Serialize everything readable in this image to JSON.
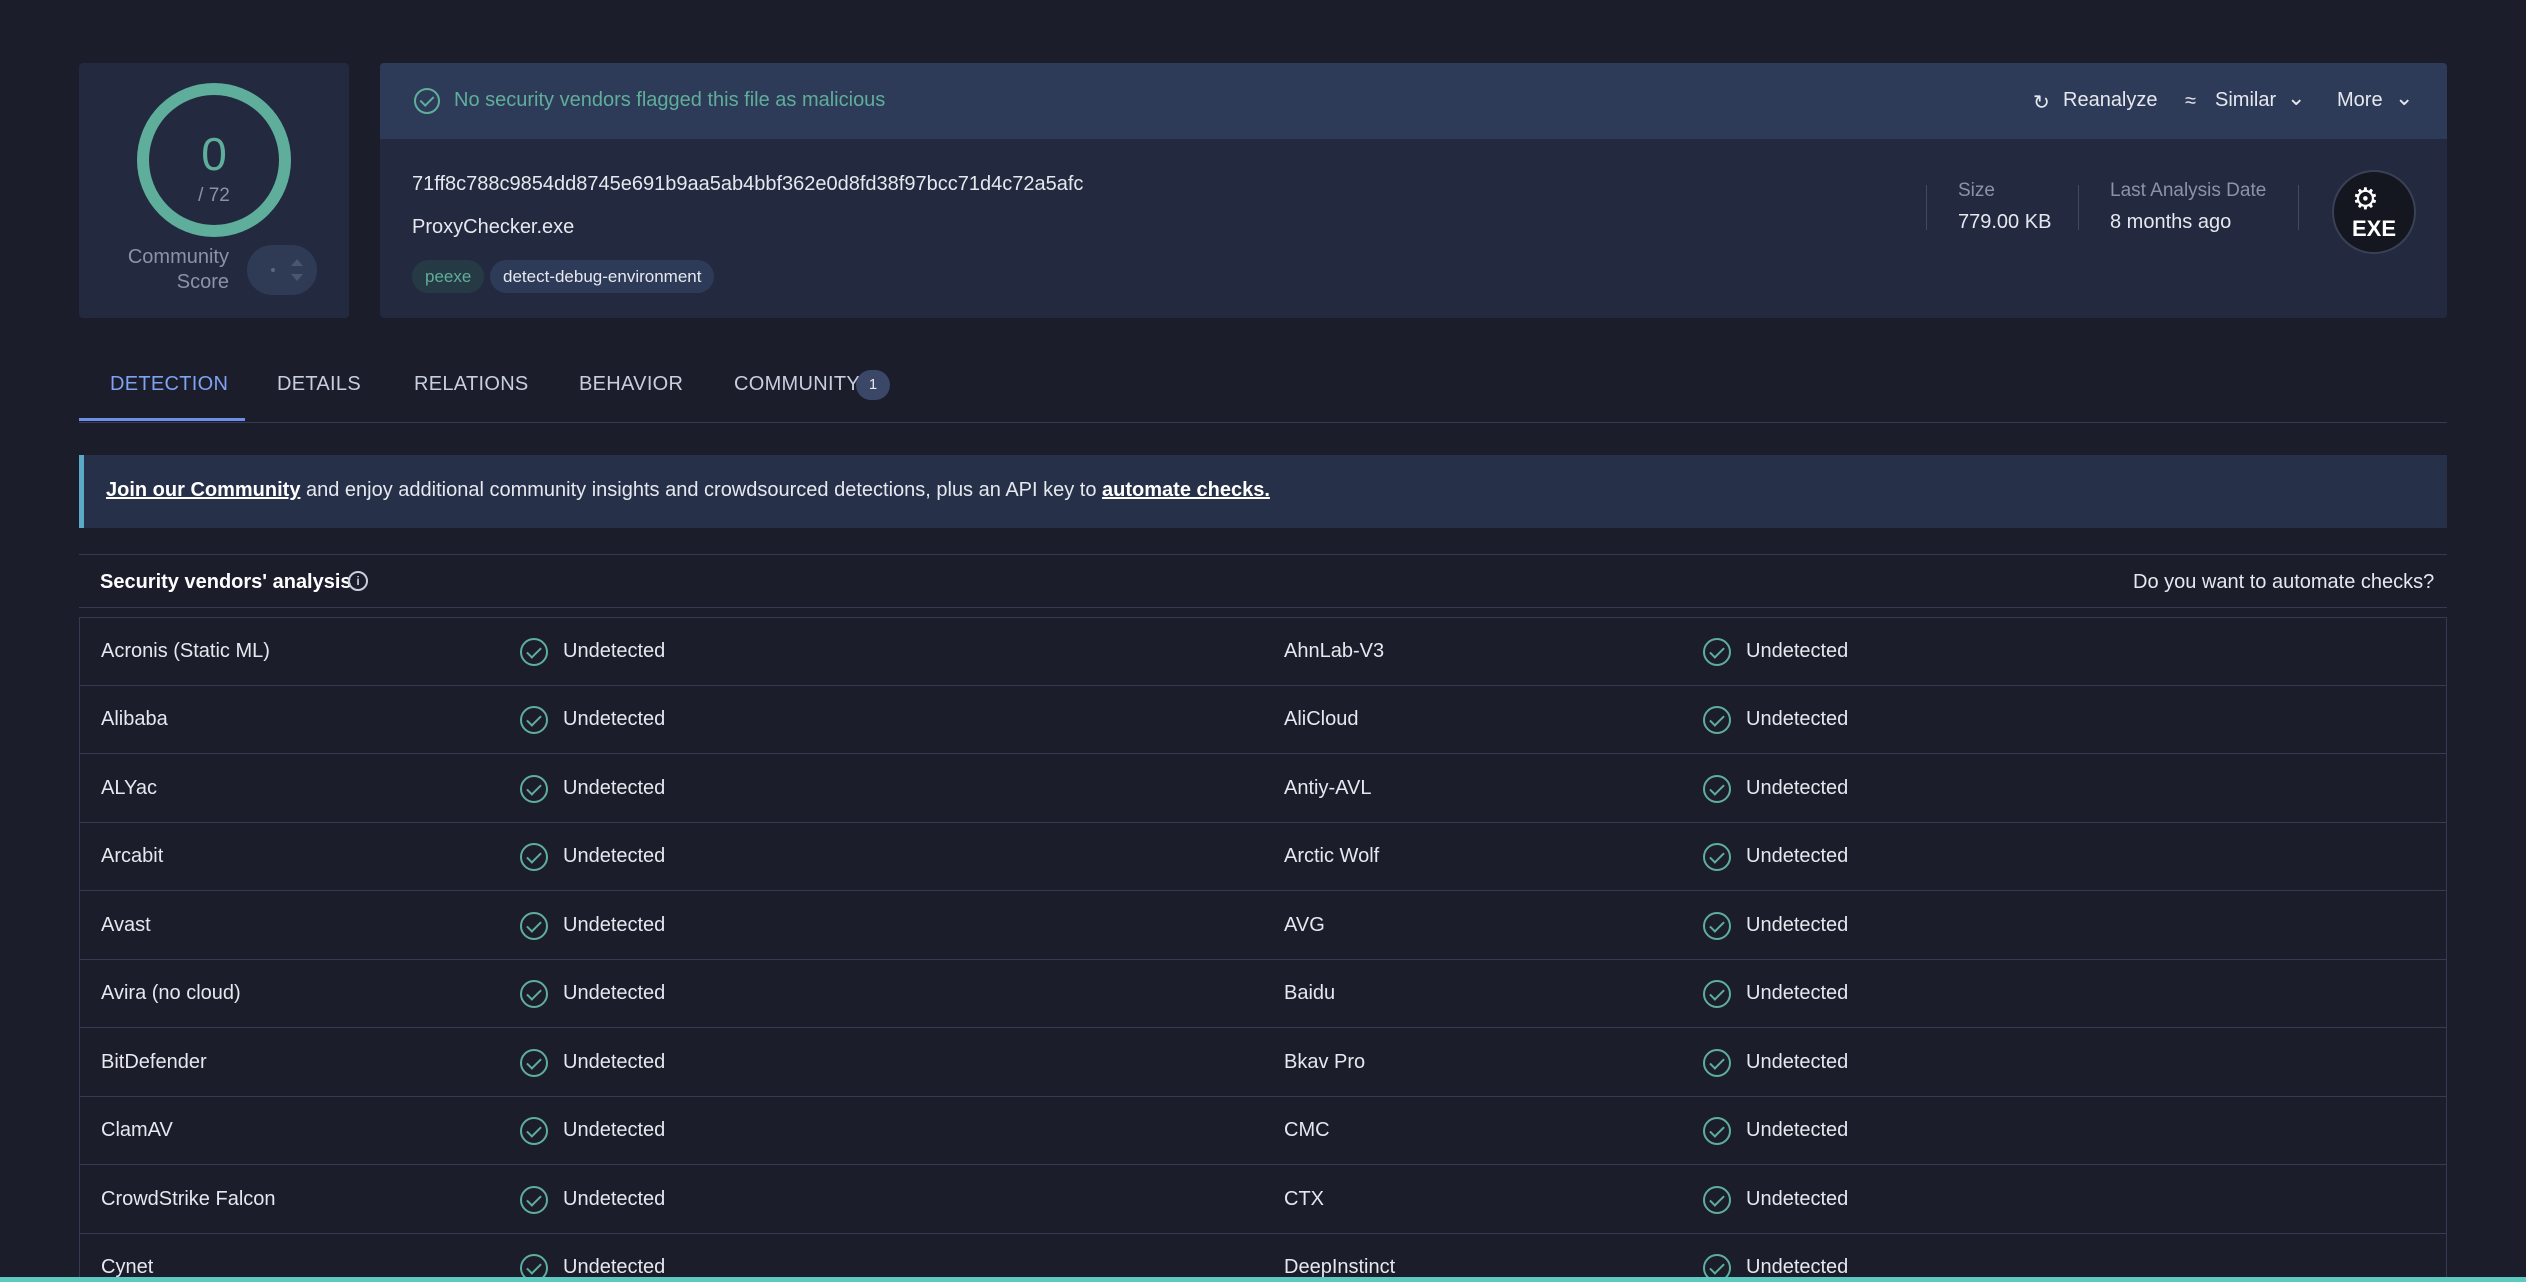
{
  "score": {
    "detections": "0",
    "total": "/ 72",
    "community_label_1": "Community",
    "community_label_2": "Score"
  },
  "status": {
    "message": "No security vendors flagged this file as malicious",
    "color": "#5fae9b"
  },
  "actions": {
    "reanalyze": "Reanalyze",
    "similar": "Similar",
    "more": "More"
  },
  "file": {
    "hash": "71ff8c788c9854dd8745e691b9aa5ab4bbf362e0d8fd38f97bcc71d4c72a5afc",
    "name": "ProxyChecker.exe",
    "tags": [
      "peexe",
      "detect-debug-environment"
    ],
    "size_label": "Size",
    "size_value": "779.00 KB",
    "date_label": "Last Analysis Date",
    "date_value": "8 months ago",
    "type_icon": "EXE"
  },
  "tabs": [
    {
      "label": "DETECTION",
      "active": true
    },
    {
      "label": "DETAILS"
    },
    {
      "label": "RELATIONS"
    },
    {
      "label": "BEHAVIOR"
    },
    {
      "label": "COMMUNITY",
      "badge": "1"
    }
  ],
  "banner": {
    "link1": "Join our Community",
    "middle": " and enjoy additional community insights and crowdsourced detections, plus an API key to ",
    "link2": "automate checks."
  },
  "section": {
    "title": "Security vendors' analysis",
    "automate_question": "Do you want to automate checks?"
  },
  "vendors": [
    {
      "left": "Acronis (Static ML)",
      "left_result": "Undetected",
      "right": "AhnLab-V3",
      "right_result": "Undetected"
    },
    {
      "left": "Alibaba",
      "left_result": "Undetected",
      "right": "AliCloud",
      "right_result": "Undetected"
    },
    {
      "left": "ALYac",
      "left_result": "Undetected",
      "right": "Antiy-AVL",
      "right_result": "Undetected"
    },
    {
      "left": "Arcabit",
      "left_result": "Undetected",
      "right": "Arctic Wolf",
      "right_result": "Undetected"
    },
    {
      "left": "Avast",
      "left_result": "Undetected",
      "right": "AVG",
      "right_result": "Undetected"
    },
    {
      "left": "Avira (no cloud)",
      "left_result": "Undetected",
      "right": "Baidu",
      "right_result": "Undetected"
    },
    {
      "left": "BitDefender",
      "left_result": "Undetected",
      "right": "Bkav Pro",
      "right_result": "Undetected"
    },
    {
      "left": "ClamAV",
      "left_result": "Undetected",
      "right": "CMC",
      "right_result": "Undetected"
    },
    {
      "left": "CrowdStrike Falcon",
      "left_result": "Undetected",
      "right": "CTX",
      "right_result": "Undetected"
    },
    {
      "left": "Cynet",
      "left_result": "Undetected",
      "right": "DeepInstinct",
      "right_result": "Undetected"
    }
  ]
}
